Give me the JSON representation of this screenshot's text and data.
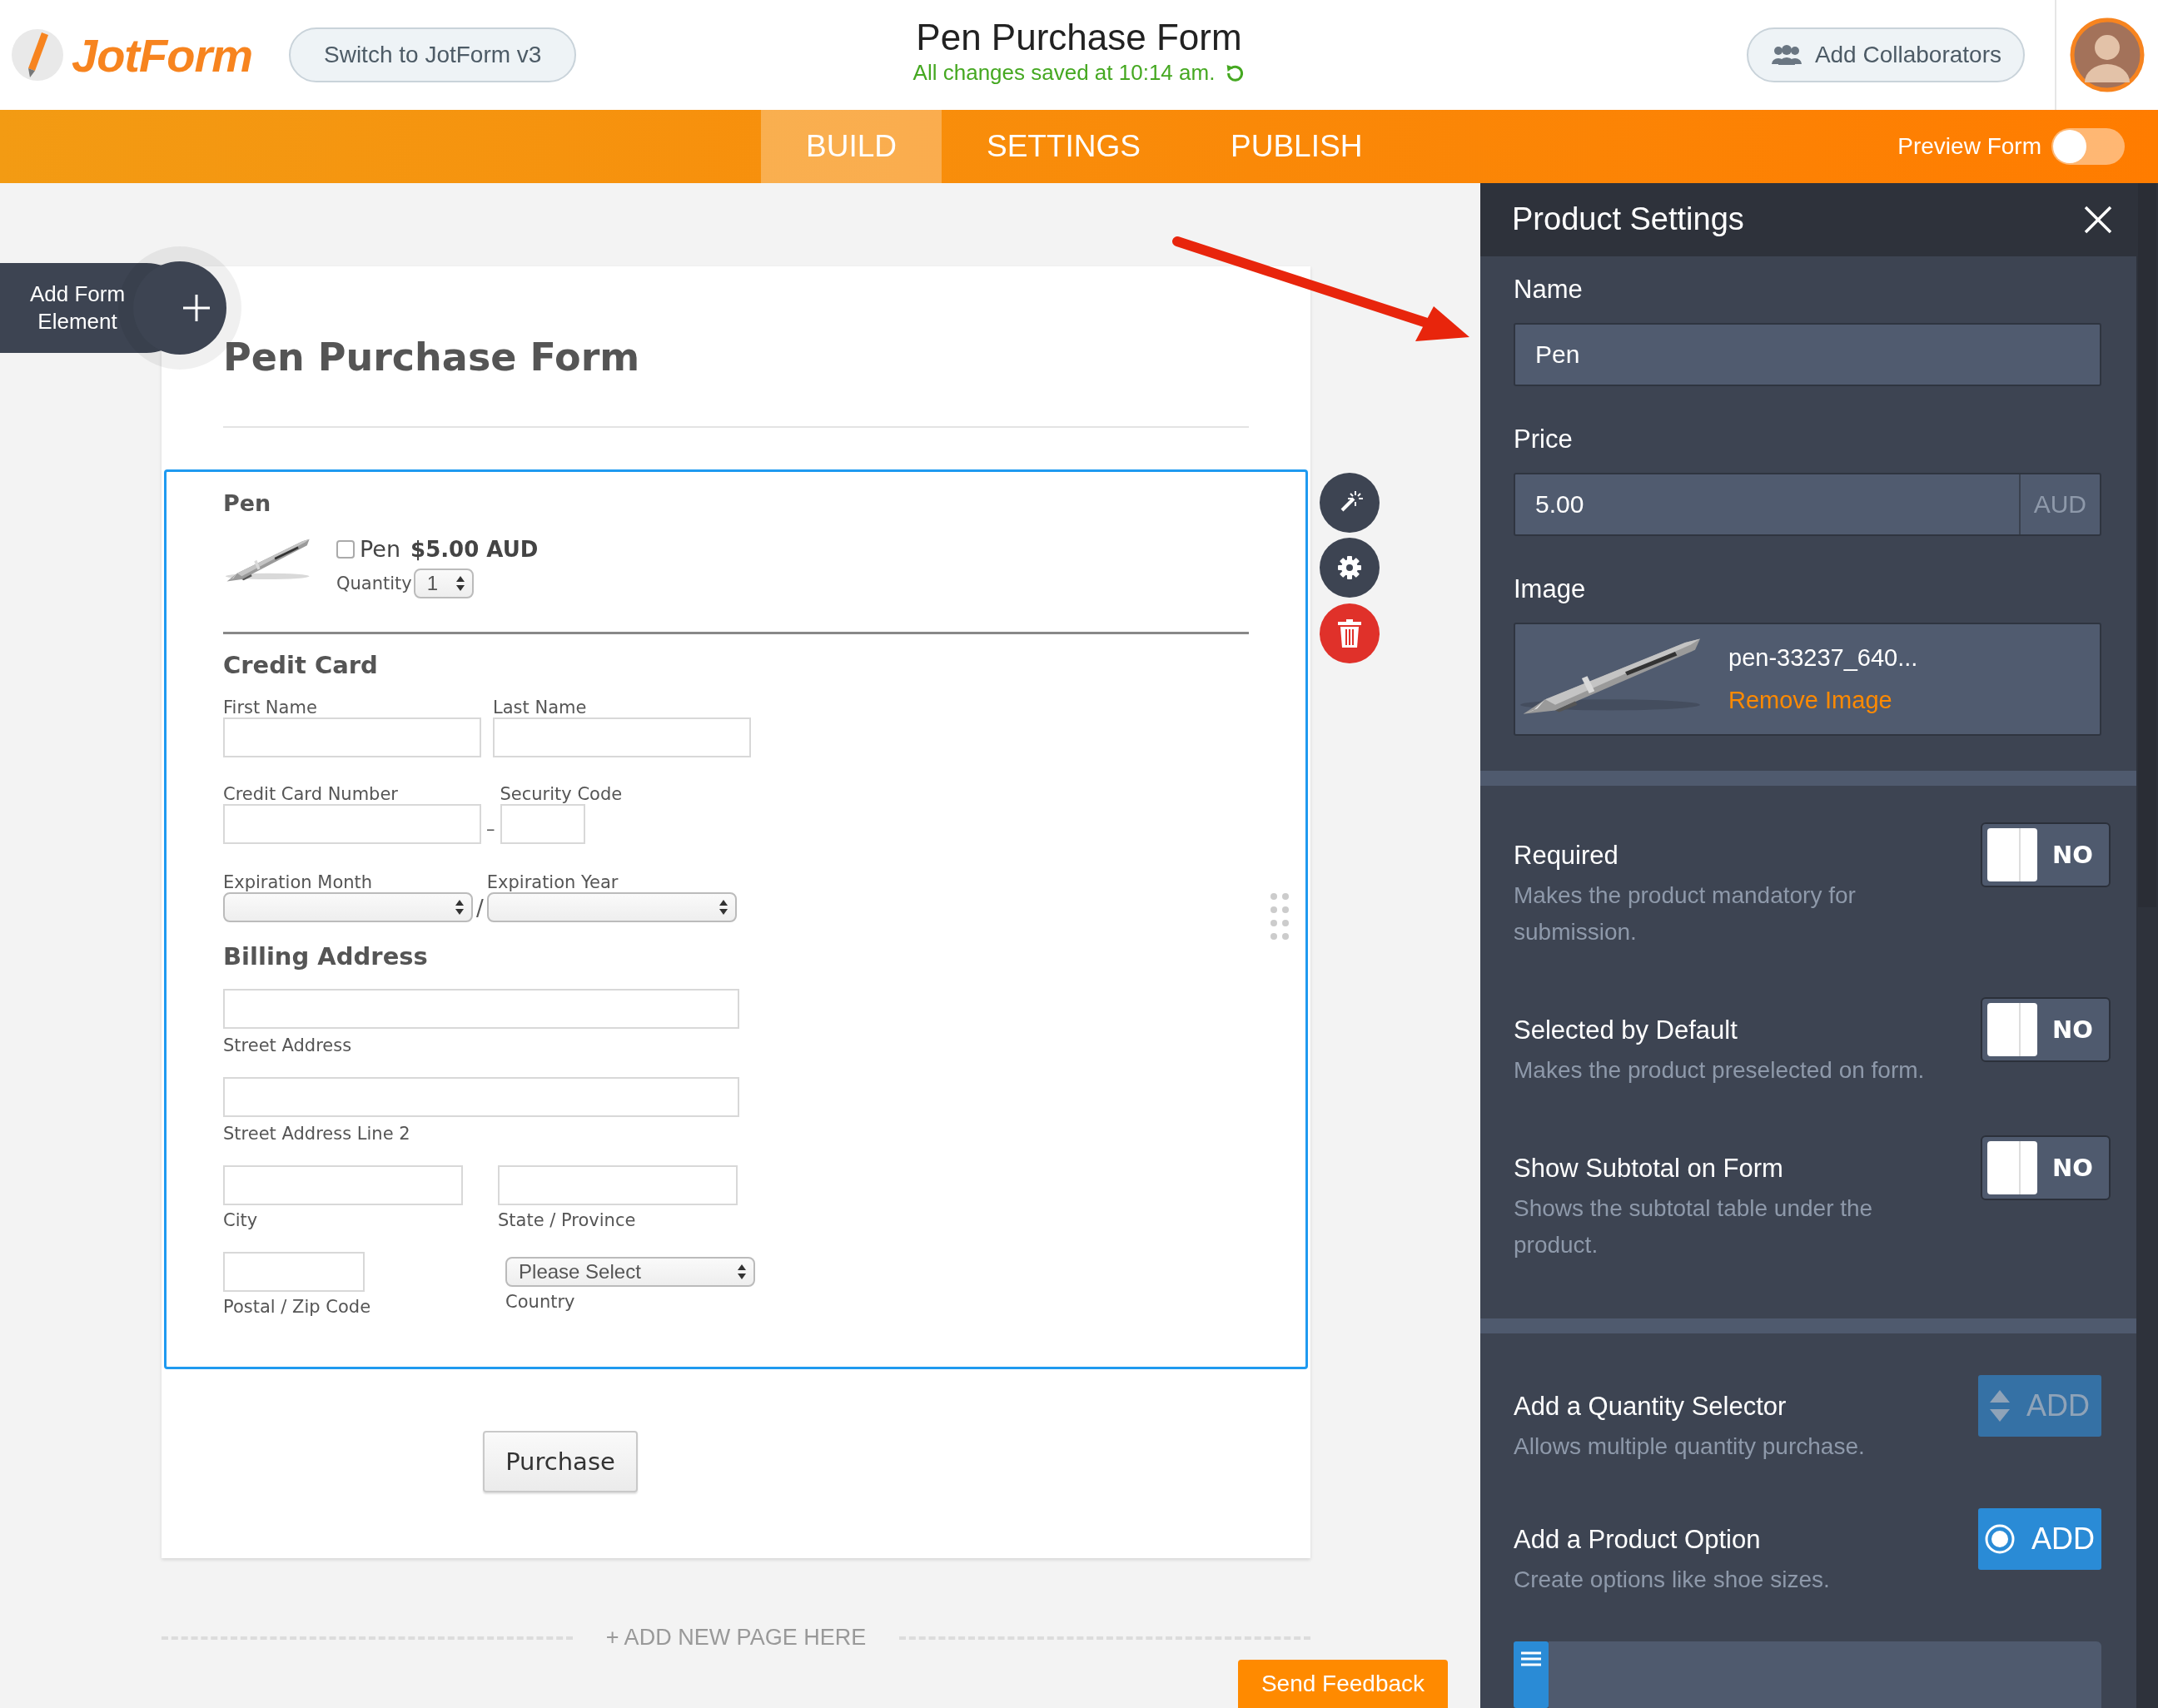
{
  "header": {
    "logo": "JotForm",
    "switch_button": "Switch to JotForm v3",
    "title": "Pen Purchase Form",
    "save_status": "All changes saved at 10:14 am.",
    "collaborators_button": "Add Collaborators"
  },
  "nav": {
    "tabs": [
      {
        "label": "BUILD",
        "selected": true
      },
      {
        "label": "SETTINGS",
        "selected": false
      },
      {
        "label": "PUBLISH",
        "selected": false
      }
    ],
    "preview": {
      "label": "Preview Form",
      "on": false
    }
  },
  "add_element": {
    "label": "Add Form Element"
  },
  "form": {
    "title": "Pen Purchase Form",
    "product": {
      "heading": "Pen",
      "checked": false,
      "name": "Pen",
      "price": "$5.00 AUD",
      "quantity_label": "Quantity",
      "quantity": "1"
    },
    "credit_card": {
      "heading": "Credit Card",
      "first_name": "First Name",
      "last_name": "Last Name",
      "card_number": "Credit Card Number",
      "number_separator": "–",
      "security_code": "Security Code",
      "exp_month": "Expiration Month",
      "exp_separator": "/",
      "exp_year": "Expiration Year"
    },
    "billing": {
      "heading": "Billing Address",
      "street": "Street Address",
      "street2": "Street Address Line 2",
      "city": "City",
      "state": "State / Province",
      "postal": "Postal / Zip Code",
      "country_value": "Please Select",
      "country": "Country"
    },
    "submit": "Purchase"
  },
  "add_page": "+ ADD NEW PAGE HERE",
  "feedback_button": "Send Feedback",
  "panel": {
    "title": "Product Settings",
    "name_label": "Name",
    "name_value": "Pen",
    "price_label": "Price",
    "price_value": "5.00",
    "currency": "AUD",
    "image_label": "Image",
    "image_file": "pen-33237_640...",
    "remove_image": "Remove Image",
    "toggles": [
      {
        "title": "Required",
        "description": "Makes the product mandatory for submission.",
        "on": false,
        "state_label": "NO"
      },
      {
        "title": "Selected by Default",
        "description": "Makes the product preselected on form.",
        "on": false,
        "state_label": "NO"
      },
      {
        "title": "Show Subtotal on Form",
        "description": "Shows the subtotal table under the product.",
        "on": false,
        "state_label": "NO"
      }
    ],
    "adders": [
      {
        "kind": "quantity",
        "title": "Add a Quantity Selector",
        "description": "Allows multiple quantity purchase.",
        "button": "ADD",
        "disabled": true
      },
      {
        "kind": "option",
        "title": "Add a Product Option",
        "description": "Create options like shoe sizes.",
        "button": "ADD",
        "disabled": false
      }
    ]
  }
}
